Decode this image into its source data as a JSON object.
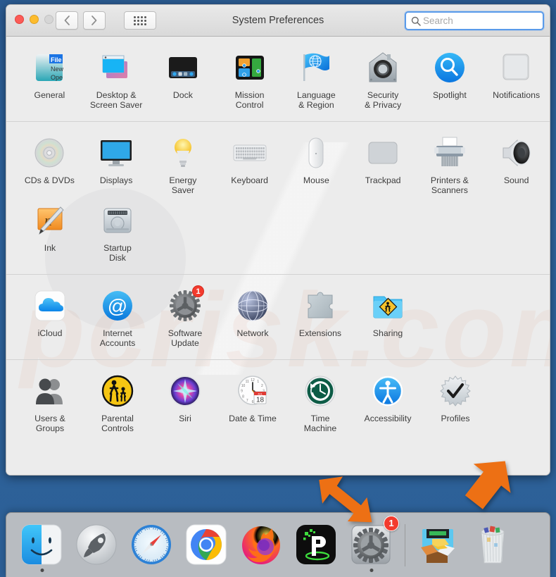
{
  "window": {
    "title": "System Preferences",
    "traffic_lights": [
      "close",
      "minimize",
      "zoom"
    ],
    "nav_back_label": "‹",
    "nav_forward_label": "›",
    "grid_button_name": "show-all-button"
  },
  "search": {
    "placeholder": "Search",
    "value": "",
    "icon": "search-icon"
  },
  "sections": [
    {
      "name": "personal",
      "rows": [
        [
          {
            "label": "General",
            "icon": "general-icon",
            "badge": null
          },
          {
            "label": "Desktop &\nScreen Saver",
            "icon": "desktop-screensaver-icon",
            "badge": null
          },
          {
            "label": "Dock",
            "icon": "dock-icon",
            "badge": null
          },
          {
            "label": "Mission\nControl",
            "icon": "mission-control-icon",
            "badge": null
          },
          {
            "label": "Language\n& Region",
            "icon": "language-region-icon",
            "badge": null
          },
          {
            "label": "Security\n& Privacy",
            "icon": "security-privacy-icon",
            "badge": null
          },
          {
            "label": "Spotlight",
            "icon": "spotlight-icon",
            "badge": null
          },
          {
            "label": "Notifications",
            "icon": "notifications-icon",
            "badge": null
          }
        ]
      ]
    },
    {
      "name": "hardware",
      "rows": [
        [
          {
            "label": "CDs & DVDs",
            "icon": "cds-dvds-icon",
            "badge": null
          },
          {
            "label": "Displays",
            "icon": "displays-icon",
            "badge": null
          },
          {
            "label": "Energy\nSaver",
            "icon": "energy-saver-icon",
            "badge": null
          },
          {
            "label": "Keyboard",
            "icon": "keyboard-icon",
            "badge": null
          },
          {
            "label": "Mouse",
            "icon": "mouse-icon",
            "badge": null
          },
          {
            "label": "Trackpad",
            "icon": "trackpad-icon",
            "badge": null
          },
          {
            "label": "Printers &\nScanners",
            "icon": "printers-scanners-icon",
            "badge": null
          },
          {
            "label": "Sound",
            "icon": "sound-icon",
            "badge": null
          }
        ],
        [
          {
            "label": "Ink",
            "icon": "ink-icon",
            "badge": null
          },
          {
            "label": "Startup\nDisk",
            "icon": "startup-disk-icon",
            "badge": null
          }
        ]
      ]
    },
    {
      "name": "internet-wireless",
      "rows": [
        [
          {
            "label": "iCloud",
            "icon": "icloud-icon",
            "badge": null
          },
          {
            "label": "Internet\nAccounts",
            "icon": "internet-accounts-icon",
            "badge": null
          },
          {
            "label": "Software\nUpdate",
            "icon": "software-update-icon",
            "badge": "1"
          },
          {
            "label": "Network",
            "icon": "network-icon",
            "badge": null
          },
          {
            "label": "Extensions",
            "icon": "extensions-icon",
            "badge": null
          },
          {
            "label": "Sharing",
            "icon": "sharing-icon",
            "badge": null
          }
        ]
      ]
    },
    {
      "name": "system",
      "rows": [
        [
          {
            "label": "Users &\nGroups",
            "icon": "users-groups-icon",
            "badge": null
          },
          {
            "label": "Parental\nControls",
            "icon": "parental-controls-icon",
            "badge": null
          },
          {
            "label": "Siri",
            "icon": "siri-icon",
            "badge": null
          },
          {
            "label": "Date & Time",
            "icon": "date-time-icon",
            "badge": null
          },
          {
            "label": "Time\nMachine",
            "icon": "time-machine-icon",
            "badge": null
          },
          {
            "label": "Accessibility",
            "icon": "accessibility-icon",
            "badge": null
          },
          {
            "label": "Profiles",
            "icon": "profiles-icon",
            "badge": null
          }
        ]
      ]
    }
  ],
  "dock": {
    "items": [
      {
        "name": "finder",
        "icon": "finder-icon",
        "running": true,
        "badge": null
      },
      {
        "name": "launchpad",
        "icon": "launchpad-icon",
        "running": false,
        "badge": null
      },
      {
        "name": "safari",
        "icon": "safari-icon",
        "running": false,
        "badge": null
      },
      {
        "name": "chrome",
        "icon": "chrome-icon",
        "running": false,
        "badge": null
      },
      {
        "name": "firefox",
        "icon": "firefox-icon",
        "running": false,
        "badge": null
      },
      {
        "name": "ipvanish",
        "icon": "ipvanish-icon",
        "running": false,
        "badge": null
      },
      {
        "name": "system-preferences",
        "icon": "system-preferences-icon",
        "running": true,
        "badge": "1"
      }
    ],
    "trailing": [
      {
        "name": "downloads-stack",
        "icon": "downloads-stack-icon"
      },
      {
        "name": "trash",
        "icon": "trash-icon"
      }
    ]
  },
  "annotations": {
    "arrows": [
      {
        "name": "arrow-pointing-to-dock-system-preferences",
        "color": "#ED7014",
        "direction": "down-right"
      },
      {
        "name": "arrow-pointing-to-profiles",
        "color": "#ED7014",
        "direction": "up-left"
      }
    ]
  },
  "colors": {
    "accent": "#ED7014",
    "badge": "#f33b2e",
    "desktop": "#2f66a0",
    "window_bg": "#ececec",
    "search_focus": "#5a9bea"
  },
  "watermark": {
    "text": "pcrisk.com"
  }
}
